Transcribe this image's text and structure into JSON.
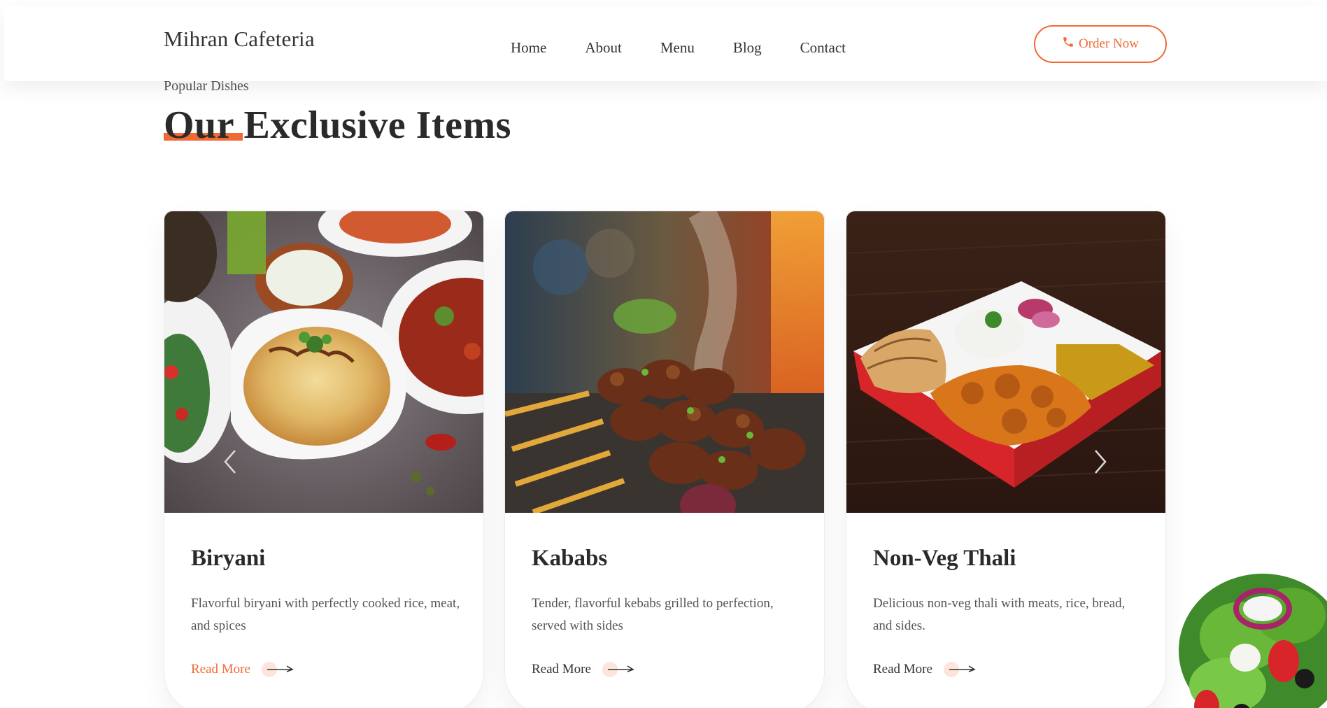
{
  "header": {
    "brand": "Mihran Cafeteria",
    "nav": [
      "Home",
      "About",
      "Menu",
      "Blog",
      "Contact"
    ],
    "order_label": "Order Now"
  },
  "section": {
    "eyebrow": "Popular Dishes",
    "heading": "Our Exclusive Items"
  },
  "cards": [
    {
      "title": "Biryani",
      "description": "Flavorful biryani with perfectly cooked rice, meat, and spices",
      "link": "Read More"
    },
    {
      "title": "Kababs",
      "description": "Tender, flavorful kebabs grilled to perfection, served with sides",
      "link": "Read More"
    },
    {
      "title": "Non-Veg Thali",
      "description": "Delicious non-veg thali with meats, rice, bread, and sides.",
      "link": "Read More"
    }
  ],
  "icons": {
    "order": "phone-icon",
    "prev": "chevron-left-icon",
    "next": "chevron-right-icon",
    "read_more": "arrow-right-icon"
  },
  "colors": {
    "accent": "#f06a35",
    "text": "#2a2a2a",
    "muted": "#555555"
  }
}
